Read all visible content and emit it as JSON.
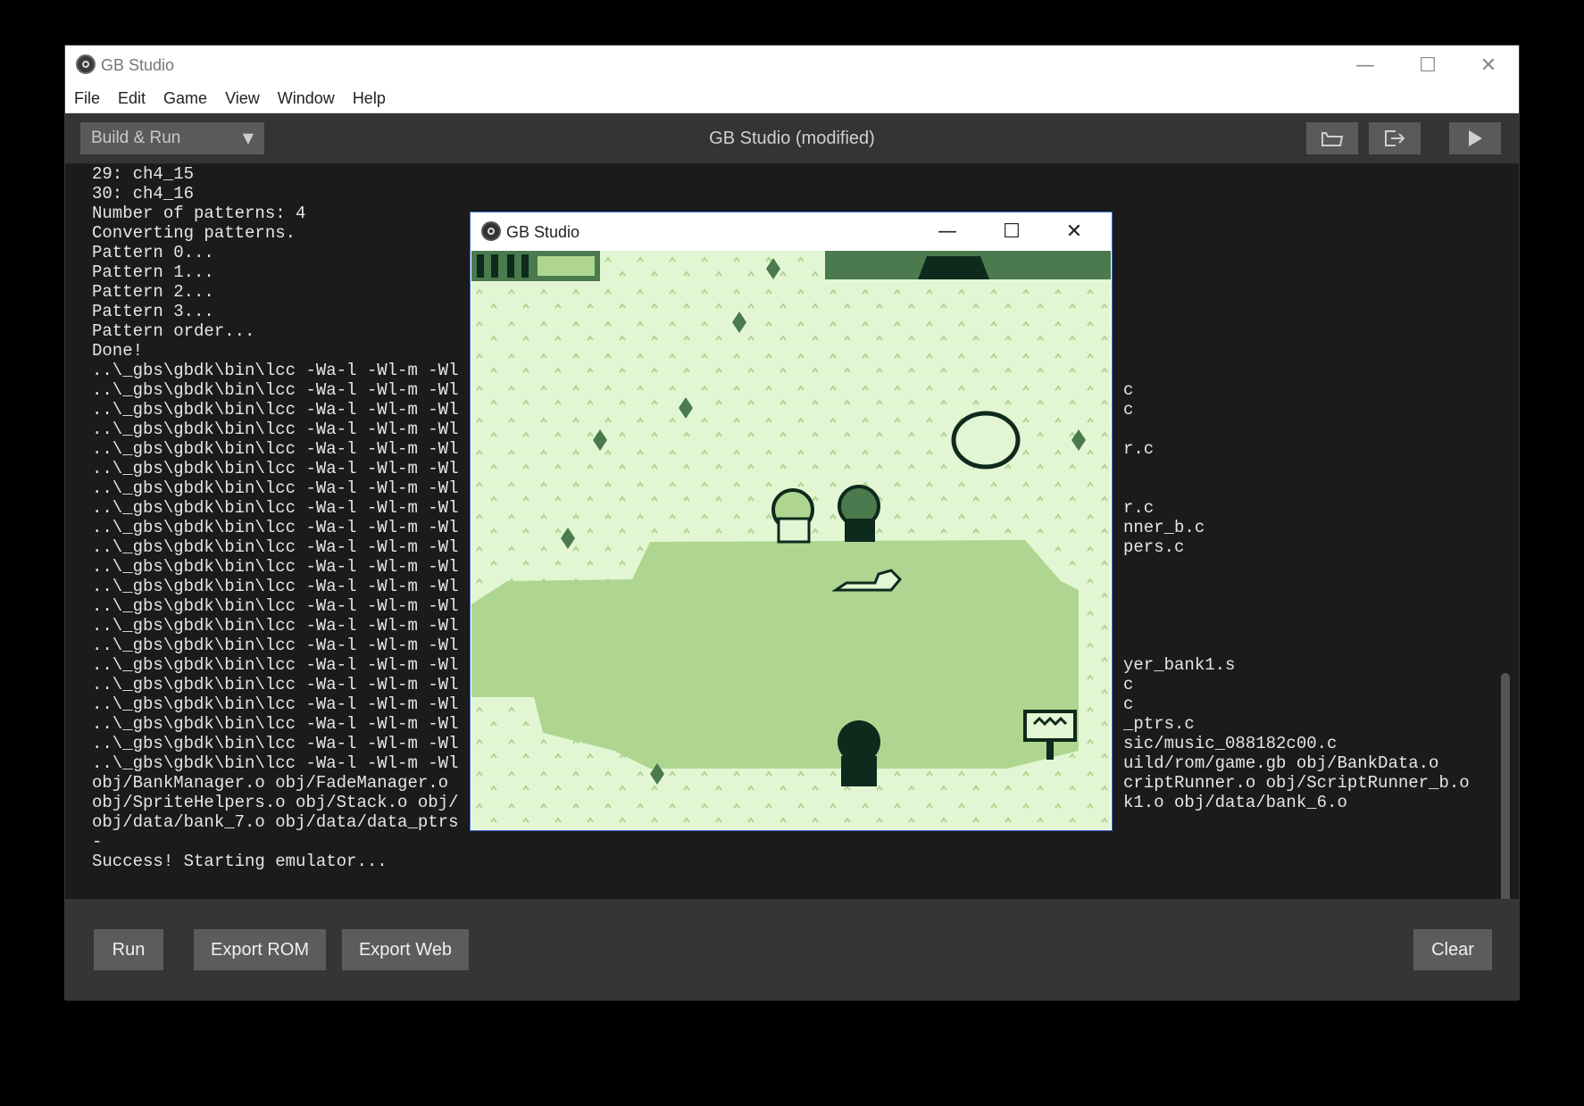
{
  "window": {
    "title": "GB Studio",
    "controls": {
      "minimize": "—",
      "maximize": "☐",
      "close": "✕"
    }
  },
  "menu": [
    "File",
    "Edit",
    "Game",
    "View",
    "Window",
    "Help"
  ],
  "toolbar": {
    "select_label": "Build & Run",
    "title": "GB Studio (modified)",
    "icons": [
      "folder-open-icon",
      "export-icon",
      "play-icon"
    ]
  },
  "console": {
    "lines": [
      "29: ch4_15",
      "30: ch4_16",
      "Number of patterns: 4",
      "Converting patterns.",
      "Pattern 0...",
      "Pattern 1...",
      "Pattern 2...",
      "Pattern 3...",
      "Pattern order...",
      "Done!",
      "..\\_gbs\\gbdk\\bin\\lcc -Wa-l -Wl-m -Wl",
      "..\\_gbs\\gbdk\\bin\\lcc -Wa-l -Wl-m -Wl",
      "..\\_gbs\\gbdk\\bin\\lcc -Wa-l -Wl-m -Wl",
      "..\\_gbs\\gbdk\\bin\\lcc -Wa-l -Wl-m -Wl",
      "..\\_gbs\\gbdk\\bin\\lcc -Wa-l -Wl-m -Wl",
      "..\\_gbs\\gbdk\\bin\\lcc -Wa-l -Wl-m -Wl",
      "..\\_gbs\\gbdk\\bin\\lcc -Wa-l -Wl-m -Wl",
      "..\\_gbs\\gbdk\\bin\\lcc -Wa-l -Wl-m -Wl",
      "..\\_gbs\\gbdk\\bin\\lcc -Wa-l -Wl-m -Wl",
      "..\\_gbs\\gbdk\\bin\\lcc -Wa-l -Wl-m -Wl",
      "..\\_gbs\\gbdk\\bin\\lcc -Wa-l -Wl-m -Wl",
      "..\\_gbs\\gbdk\\bin\\lcc -Wa-l -Wl-m -Wl",
      "..\\_gbs\\gbdk\\bin\\lcc -Wa-l -Wl-m -Wl",
      "..\\_gbs\\gbdk\\bin\\lcc -Wa-l -Wl-m -Wl",
      "..\\_gbs\\gbdk\\bin\\lcc -Wa-l -Wl-m -Wl",
      "..\\_gbs\\gbdk\\bin\\lcc -Wa-l -Wl-m -Wl",
      "..\\_gbs\\gbdk\\bin\\lcc -Wa-l -Wl-m -Wl",
      "..\\_gbs\\gbdk\\bin\\lcc -Wa-l -Wl-m -Wl",
      "..\\_gbs\\gbdk\\bin\\lcc -Wa-l -Wl-m -Wl",
      "..\\_gbs\\gbdk\\bin\\lcc -Wa-l -Wl-m -Wl",
      "..\\_gbs\\gbdk\\bin\\lcc -Wa-l -Wl-m -Wl",
      "obj/BankManager.o obj/FadeManager.o",
      "obj/SpriteHelpers.o obj/Stack.o obj/",
      "obj/data/bank_7.o obj/data/data_ptrs",
      "-",
      "Success! Starting emulator..."
    ],
    "right_fragments": [
      {
        "text": "c",
        "row": 11
      },
      {
        "text": "c",
        "row": 12
      },
      {
        "text": "r.c",
        "row": 14
      },
      {
        "text": "r.c",
        "row": 17
      },
      {
        "text": "nner_b.c",
        "row": 18
      },
      {
        "text": "pers.c",
        "row": 19
      },
      {
        "text": "yer_bank1.s",
        "row": 25
      },
      {
        "text": "c",
        "row": 26
      },
      {
        "text": "c",
        "row": 27
      },
      {
        "text": "_ptrs.c",
        "row": 28
      },
      {
        "text": "sic/music_088182c00.c",
        "row": 29
      },
      {
        "text": "uild/rom/game.gb obj/BankData.o",
        "row": 30
      },
      {
        "text": "criptRunner.o obj/ScriptRunner_b.o",
        "row": 31
      },
      {
        "text": "k1.o obj/data/bank_6.o",
        "row": 32
      }
    ]
  },
  "buttons": {
    "run": "Run",
    "export_rom": "Export ROM",
    "export_web": "Export Web",
    "clear": "Clear"
  },
  "emulator": {
    "title": "GB Studio",
    "controls": {
      "minimize": "—",
      "maximize": "☐",
      "close": "✕"
    },
    "palette": {
      "lightest": "#e3f6d3",
      "light": "#aed690",
      "dark": "#4a7a4e",
      "darkest": "#0e2a1c"
    }
  }
}
